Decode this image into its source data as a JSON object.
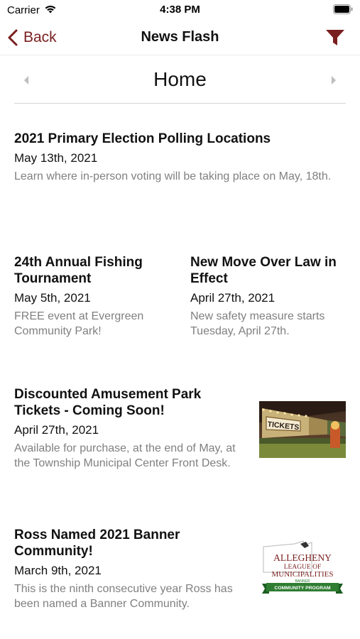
{
  "status_bar": {
    "carrier": "Carrier",
    "time": "4:38 PM",
    "icons": [
      "wifi-icon",
      "battery-icon"
    ]
  },
  "nav": {
    "back_label": "Back",
    "title": "News Flash",
    "icons": [
      "chevron-left-icon",
      "filter-icon"
    ],
    "accent_color": "#7a1f1f"
  },
  "section": {
    "title": "Home",
    "icons": [
      "chevron-left-icon",
      "chevron-right-icon"
    ]
  },
  "news": [
    {
      "title": "2021 Primary Election Polling Locations",
      "date": "May 13th, 2021",
      "summary": "Learn where in-person voting will be taking place on May, 18th."
    },
    {
      "title": "24th Annual Fishing Tournament",
      "date": "May 5th, 2021",
      "summary": "FREE event at Evergreen Community Park!"
    },
    {
      "title": "New Move Over Law in Effect",
      "date": "April 27th, 2021",
      "summary": "New safety measure starts Tuesday, April 27th."
    },
    {
      "title": "Discounted Amusement Park Tickets - Coming Soon!",
      "date": "April 27th, 2021",
      "summary": "Available for purchase, at the end of May, at the Township Municipal Center Front Desk.",
      "thumbnail": {
        "sign_text": "TICKETS"
      }
    },
    {
      "title": "Ross Named 2021 Banner Community!",
      "date": "March 9th, 2021",
      "summary": "This is the ninth consecutive year Ross has been named a Banner Community.",
      "thumbnail": {
        "logo_line1": "ALLEGHENY",
        "logo_line2": "LEAGUE OF",
        "logo_line3": "MUNICIPALITIES",
        "logo_line4": "BANNER",
        "logo_line5": "COMMUNITY PROGRAM"
      }
    }
  ]
}
